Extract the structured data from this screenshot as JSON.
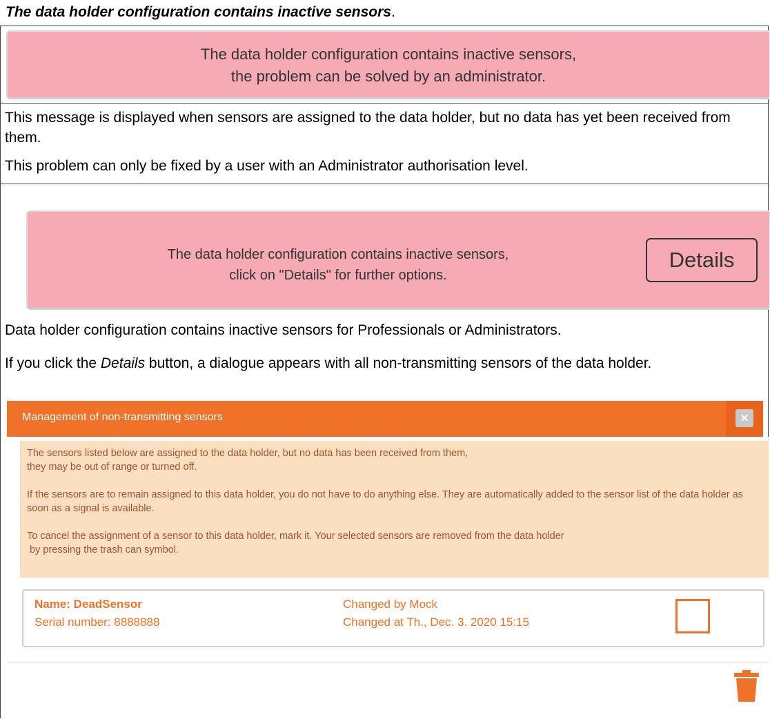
{
  "heading": {
    "title": "The data holder configuration contains inactive sensors",
    "period": "."
  },
  "banner_user": {
    "line1": "The data holder configuration contains inactive sensors,",
    "line2": "the problem can be solved by an administrator."
  },
  "description_user": {
    "p1": "This message is displayed when sensors are assigned to the data holder, but no data has yet been received from them.",
    "p2": "This problem can only be fixed by a user with an Administrator authorisation level."
  },
  "banner_admin": {
    "line1": "The data holder configuration contains inactive sensors,",
    "line2": "click on \"Details\" for further options.",
    "details_label": "Details"
  },
  "description_admin": {
    "p1": "Data holder configuration contains inactive sensors for Professionals or Administrators.",
    "p2_before": "If you click the ",
    "p2_em": "Details",
    "p2_after": " button, a dialogue appears with all non-transmitting sensors of the data holder."
  },
  "dialog": {
    "title": "Management of non-transmitting sensors",
    "close_symbol": "✕",
    "info": {
      "p1_line1": "The sensors listed below are assigned to the data holder, but no data has been received from them,",
      "p1_line2": "they may be out of range or turned off.",
      "p2": "If the sensors are to remain assigned to this data holder, you do not have to do anything else. They are automatically added to the sensor list of the data holder as soon as a signal is available.",
      "p3_line1": "To cancel the assignment of a sensor to this data holder, mark it. Your selected sensors are removed from the data holder",
      "p3_line2": " by pressing the trash can symbol."
    },
    "sensors": [
      {
        "name": "Name: DeadSensor",
        "serial": "Serial number: 8888888",
        "changed_by": "Changed by Mock",
        "changed_at": "Changed at Th., Dec. 3. 2020 15:15",
        "checked": false
      }
    ],
    "colors": {
      "accent": "#f07228",
      "info_background": "#fbdfc1",
      "banner_background": "#f5aab4"
    },
    "icons": {
      "close": "close-icon",
      "delete": "trash-icon"
    }
  }
}
